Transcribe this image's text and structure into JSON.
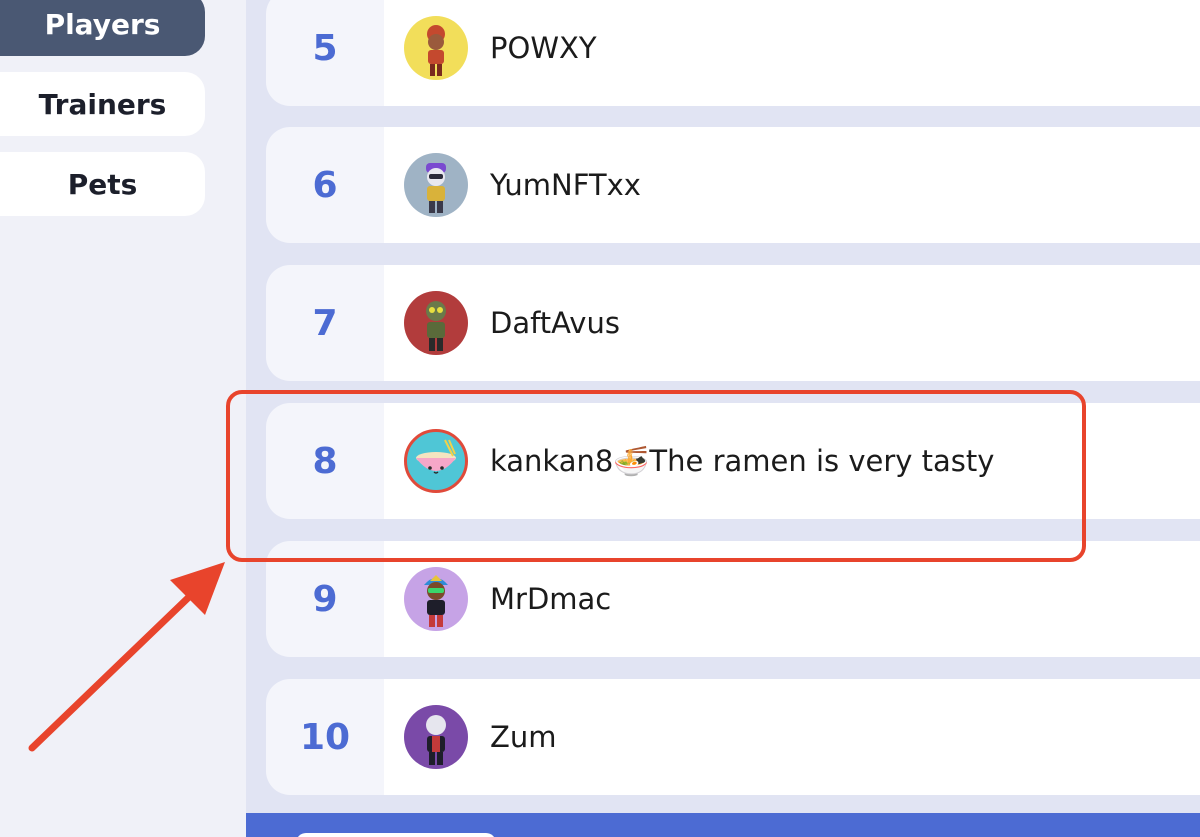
{
  "sidebar": {
    "items": [
      {
        "label": "Players",
        "active": true
      },
      {
        "label": "Trainers",
        "active": false
      },
      {
        "label": "Pets",
        "active": false
      }
    ]
  },
  "leaderboard": {
    "rows": [
      {
        "rank": "5",
        "name": "POWXY",
        "avatar_icon": "player-avatar-icon",
        "avatar_bg": "#f2de5a"
      },
      {
        "rank": "6",
        "name": "YumNFTxx",
        "avatar_icon": "player-avatar-icon",
        "avatar_bg": "#9fb3c5"
      },
      {
        "rank": "7",
        "name": "DaftAvus",
        "avatar_icon": "player-avatar-icon",
        "avatar_bg": "#b23c3c"
      },
      {
        "rank": "8",
        "name": "kankan8🍜The ramen is very tasty",
        "avatar_icon": "ramen-avatar-icon",
        "avatar_bg": "#4fc6d6"
      },
      {
        "rank": "9",
        "name": "MrDmac",
        "avatar_icon": "player-avatar-icon",
        "avatar_bg": "#c6a3e6"
      },
      {
        "rank": "10",
        "name": "Zum",
        "avatar_icon": "player-avatar-icon",
        "avatar_bg": "#7a4aa8"
      }
    ]
  },
  "annotation": {
    "highlighted_rank": "8",
    "color": "#e8442c"
  },
  "colors": {
    "accent": "#4c6bd3",
    "sidebar_active": "#4a5873"
  }
}
